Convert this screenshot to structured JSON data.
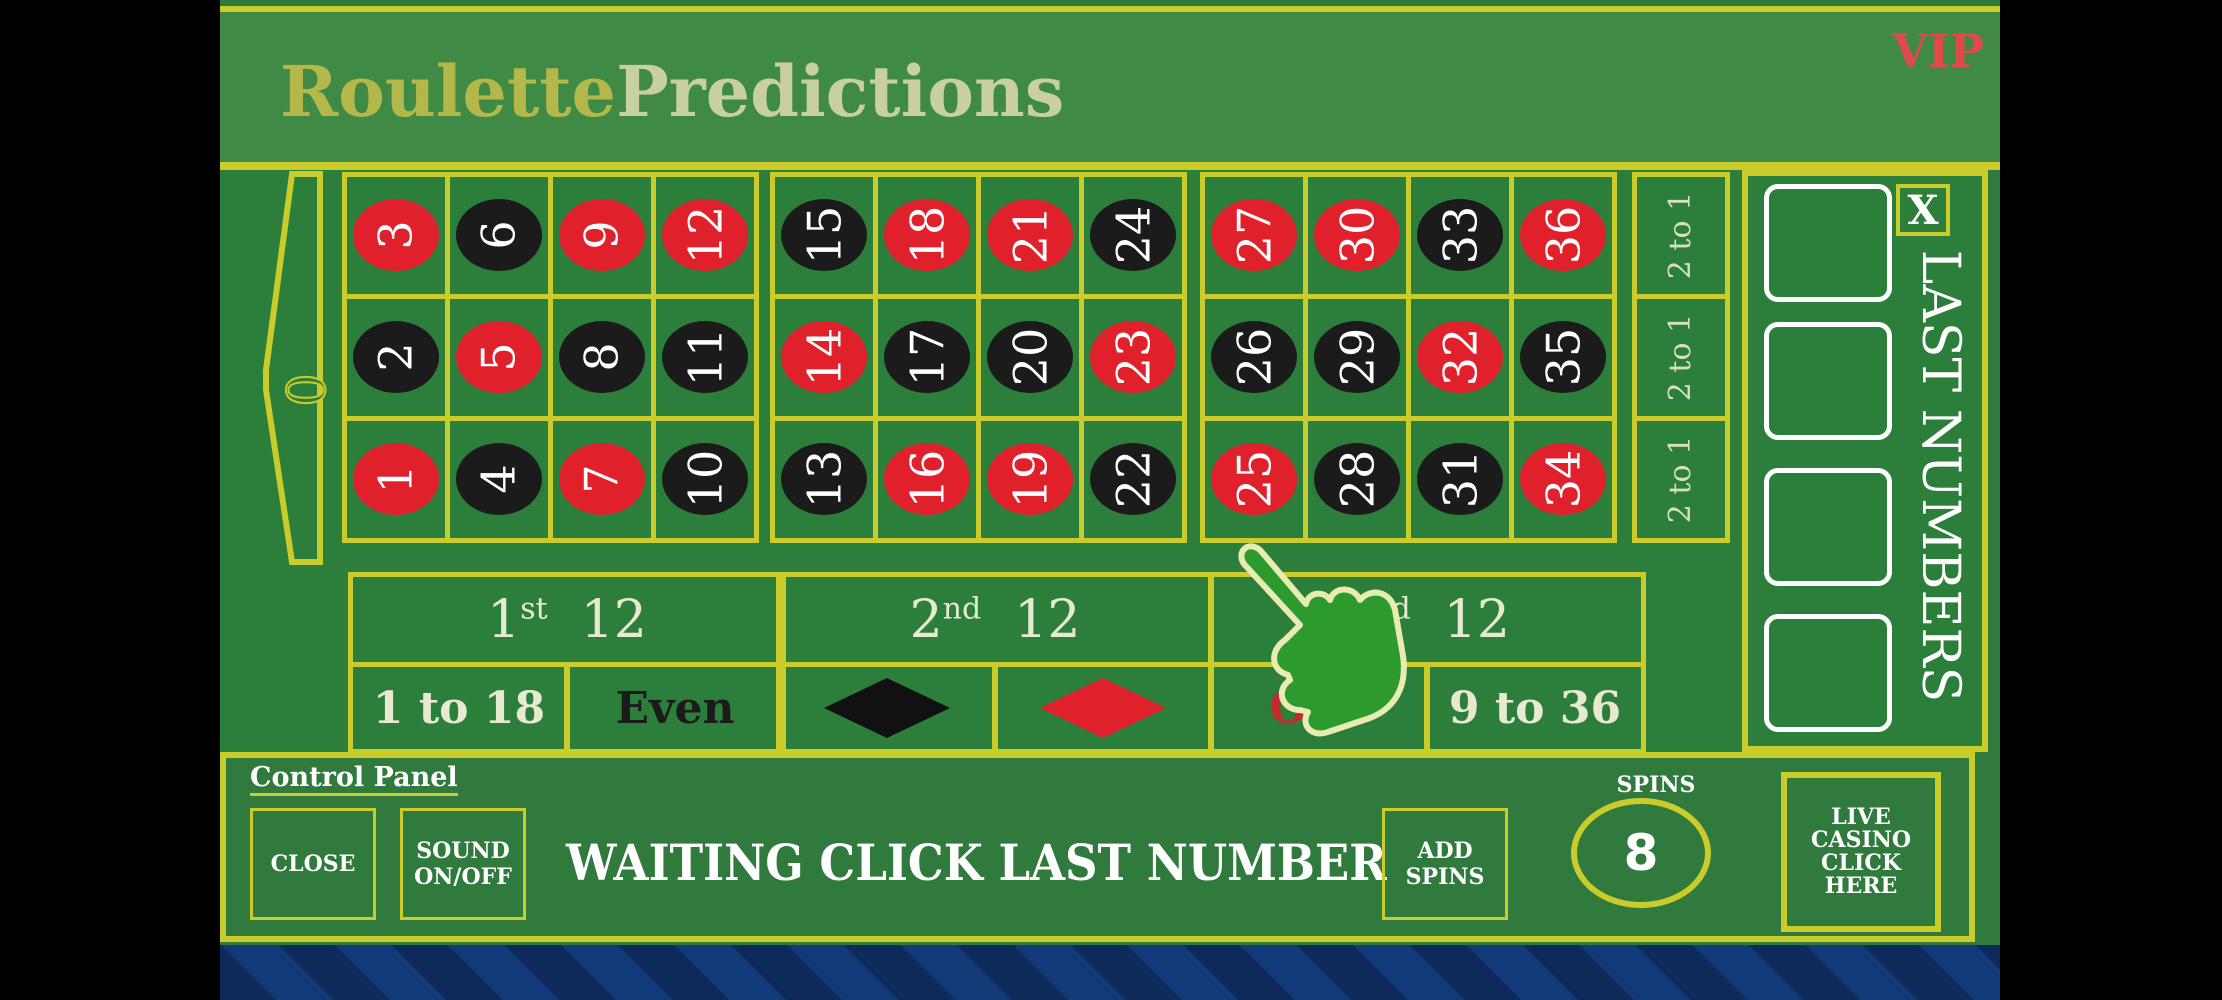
{
  "header": {
    "title_part1": "Roulette",
    "title_part2": "Predictions",
    "vip": "VIP"
  },
  "table": {
    "zero": "0",
    "rows": [
      [
        {
          "n": "3",
          "c": "red"
        },
        {
          "n": "6",
          "c": "black"
        },
        {
          "n": "9",
          "c": "red"
        },
        {
          "n": "12",
          "c": "red"
        },
        {
          "n": "15",
          "c": "black"
        },
        {
          "n": "18",
          "c": "red"
        },
        {
          "n": "21",
          "c": "red"
        },
        {
          "n": "24",
          "c": "black"
        },
        {
          "n": "27",
          "c": "red"
        },
        {
          "n": "30",
          "c": "red"
        },
        {
          "n": "33",
          "c": "black"
        },
        {
          "n": "36",
          "c": "red"
        }
      ],
      [
        {
          "n": "2",
          "c": "black"
        },
        {
          "n": "5",
          "c": "red"
        },
        {
          "n": "8",
          "c": "black"
        },
        {
          "n": "11",
          "c": "black"
        },
        {
          "n": "14",
          "c": "red"
        },
        {
          "n": "17",
          "c": "black"
        },
        {
          "n": "20",
          "c": "black"
        },
        {
          "n": "23",
          "c": "red"
        },
        {
          "n": "26",
          "c": "black"
        },
        {
          "n": "29",
          "c": "black"
        },
        {
          "n": "32",
          "c": "red"
        },
        {
          "n": "35",
          "c": "black"
        }
      ],
      [
        {
          "n": "1",
          "c": "red"
        },
        {
          "n": "4",
          "c": "black"
        },
        {
          "n": "7",
          "c": "red"
        },
        {
          "n": "10",
          "c": "black"
        },
        {
          "n": "13",
          "c": "black"
        },
        {
          "n": "16",
          "c": "red"
        },
        {
          "n": "19",
          "c": "red"
        },
        {
          "n": "22",
          "c": "black"
        },
        {
          "n": "25",
          "c": "red"
        },
        {
          "n": "28",
          "c": "black"
        },
        {
          "n": "31",
          "c": "black"
        },
        {
          "n": "34",
          "c": "red"
        }
      ]
    ],
    "column_bets": [
      "2 to 1",
      "2 to 1",
      "2 to 1"
    ],
    "dozens": [
      {
        "num": "1",
        "sup": "st",
        "label": "12"
      },
      {
        "num": "2",
        "sup": "nd",
        "label": "12"
      },
      {
        "num": "3",
        "sup": "rd",
        "label": "12"
      }
    ],
    "outside": {
      "low": "1 to 18",
      "even": "Even",
      "odd": "Odd",
      "high": "9 to 36"
    }
  },
  "last_numbers": {
    "label": "LAST NUMBERS",
    "close": "X"
  },
  "control_panel": {
    "title": "Control Panel",
    "close_label": "CLOSE",
    "sound_label": "SOUND ON/OFF",
    "status": "WAITING CLICK LAST NUMBER",
    "add_spins_label": "ADD SPINS",
    "spins_label": "SPINS",
    "spins_value": "8",
    "live_casino_label": "LIVE CASINO CLICK HERE"
  },
  "colors": {
    "accent": "#c9cc2a",
    "felt": "#2c7f3a",
    "red": "#e0202a",
    "black": "#1b1b1b"
  },
  "icons": {
    "pointer": "pointing-hand-icon"
  }
}
